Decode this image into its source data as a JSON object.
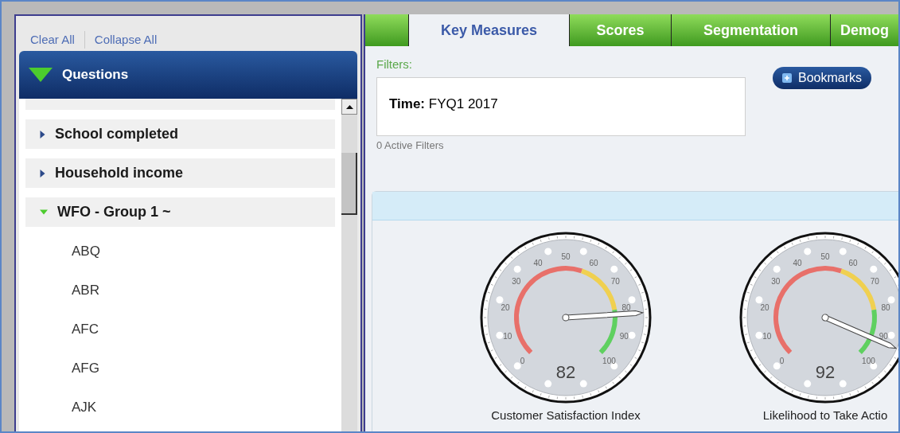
{
  "toolbar": {
    "links": [
      "Clear All",
      "Collapse All"
    ]
  },
  "questions_panel": {
    "title": "Questions",
    "expanded": true,
    "items": [
      {
        "label": "School completed",
        "expanded": false
      },
      {
        "label": "Household income",
        "expanded": false
      },
      {
        "label": "WFO - Group 1 ~",
        "expanded": true,
        "children": [
          {
            "label": "ABQ"
          },
          {
            "label": "ABR"
          },
          {
            "label": "AFC"
          },
          {
            "label": "AFG"
          },
          {
            "label": "AJK"
          }
        ]
      }
    ]
  },
  "tabs": [
    {
      "label": "Key Measures",
      "selected": true
    },
    {
      "label": "Scores",
      "selected": false
    },
    {
      "label": "Segmentation",
      "selected": false
    },
    {
      "label": "Demog",
      "selected": false
    }
  ],
  "filters": {
    "heading": "Filters:",
    "name": "Time:",
    "value": "FYQ1 2017",
    "count": "0 Active Filters"
  },
  "bookmarks_button": "Bookmarks",
  "gauges": [
    {
      "label": "Customer Satisfaction Index",
      "reading": "82",
      "scale": [
        "0",
        "10",
        "20",
        "30",
        "40",
        "50",
        "60",
        "70",
        "80",
        "90",
        "100"
      ]
    },
    {
      "label": "Likelihood to Take Actio",
      "reading": "92",
      "scale": [
        "0",
        "10",
        "20",
        "30",
        "40",
        "50",
        "60",
        "70",
        "80",
        "90",
        "100"
      ]
    }
  ]
}
